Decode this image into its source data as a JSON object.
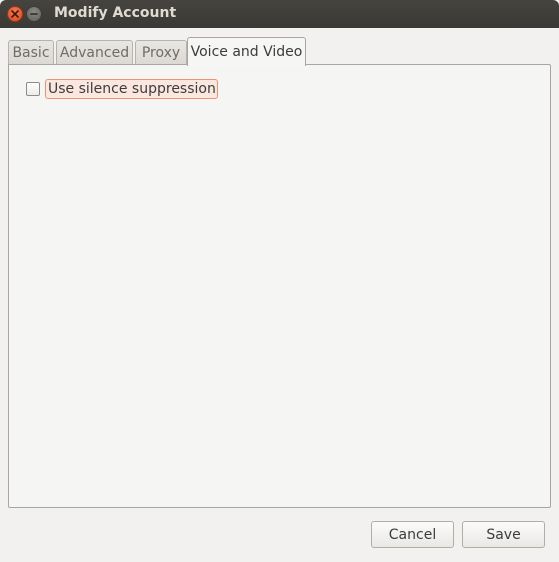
{
  "window": {
    "title": "Modify Account",
    "close_icon": "close-icon",
    "minimize_icon": "minimize-icon"
  },
  "tabs": [
    {
      "label": "Basic",
      "active": false
    },
    {
      "label": "Advanced",
      "active": false
    },
    {
      "label": "Proxy",
      "active": false
    },
    {
      "label": "Voice and Video",
      "active": true
    }
  ],
  "voice_video": {
    "silence_suppression": {
      "label": "Use silence suppression",
      "checked": false
    }
  },
  "buttons": {
    "cancel_label": "Cancel",
    "save_label": "Save"
  },
  "colors": {
    "titlebar": "#3f3e3a",
    "close_button": "#e9592b",
    "focus_highlight": "#f0926d"
  }
}
